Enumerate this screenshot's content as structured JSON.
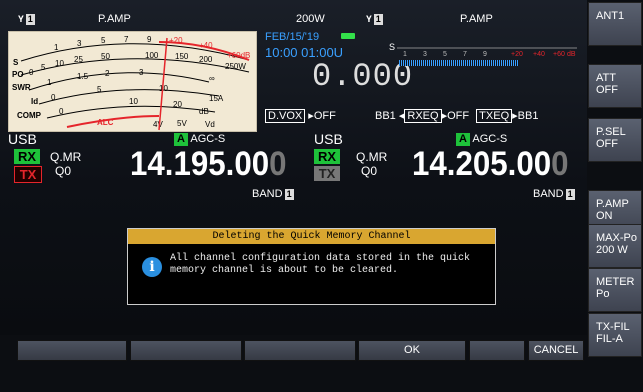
{
  "top_left": {
    "ant_icon": "antenna-icon",
    "ant_num": "1",
    "preamp": "P.AMP",
    "power": "200W"
  },
  "top_right": {
    "ant_icon": "antenna-icon",
    "ant_num": "1",
    "preamp": "P.AMP"
  },
  "meter": {
    "s_label": "S",
    "po_label": "PO",
    "swr_label": "SWR",
    "id_label": "Id",
    "comp_label": "COMP",
    "alc_label": "ALC",
    "s_scale": [
      "1",
      "3",
      "5",
      "7",
      "9",
      "+20",
      "+40",
      "+60dB"
    ],
    "po_scale": [
      "0",
      "5",
      "10",
      "25",
      "50",
      "100",
      "150",
      "200",
      "250W"
    ],
    "swr_scale": [
      "1",
      "1.5",
      "2",
      "3",
      "∞"
    ],
    "id_scale": [
      "0",
      "5",
      "10",
      "15A"
    ],
    "comp_scale": [
      "0",
      "10",
      "20",
      "dB"
    ],
    "vd_scale": [
      "4V",
      "5V",
      "Vd"
    ]
  },
  "status": {
    "date": "FEB/15/'19",
    "time": "10:00 01:00U",
    "sub_freq": "0.000",
    "dvox": "D.VOX",
    "dvox_state": "OFF",
    "bb1": "BB1",
    "rxeq": "RXEQ",
    "rxeq_state": "OFF",
    "txeq": "TXEQ",
    "txeq_state": "BB1"
  },
  "bar_meter": {
    "s_label": "S",
    "scale": [
      "1",
      "3",
      "5",
      "7",
      "9",
      "+20",
      "+40",
      "+60",
      "dB"
    ]
  },
  "vfo_a": {
    "mode": "USB",
    "agc_badge": "A",
    "agc": "AGC-S",
    "rx": "RX",
    "tx": "TX",
    "qmr": "Q.MR",
    "q0": "Q0",
    "freq_main": "14.195.00",
    "freq_last": "0",
    "band": "BAND",
    "band_num": "1"
  },
  "vfo_b": {
    "mode": "USB",
    "agc_badge": "A",
    "agc": "AGC-S",
    "rx": "RX",
    "tx": "TX",
    "qmr": "Q.MR",
    "q0": "Q0",
    "freq_main": "14.205.00",
    "freq_last": "0",
    "band": "BAND",
    "band_num": "1"
  },
  "dialog": {
    "title": "Deleting the Quick Memory Channel",
    "line1": "All channel configuration data stored in the quick",
    "line2": "memory channel is about to be cleared."
  },
  "side_buttons": [
    {
      "line1": "ANT1",
      "line2": ""
    },
    {
      "line1": "ATT",
      "line2": "OFF"
    },
    {
      "line1": "P.SEL",
      "line2": "OFF"
    },
    {
      "line1": "P.AMP",
      "line2": "ON"
    },
    {
      "line1": "MAX-Po",
      "line2": "200 W"
    },
    {
      "line1": "METER",
      "line2": "Po"
    },
    {
      "line1": "TX-FIL",
      "line2": "FIL-A"
    }
  ],
  "bottom_buttons": [
    "",
    "",
    "",
    "OK",
    "",
    "CANCEL"
  ],
  "colors": {
    "accent_blue": "#3aa0ff",
    "rx_green": "#1ec23a",
    "tx_red": "#e5252b",
    "dialog_title": "#d9a630"
  }
}
